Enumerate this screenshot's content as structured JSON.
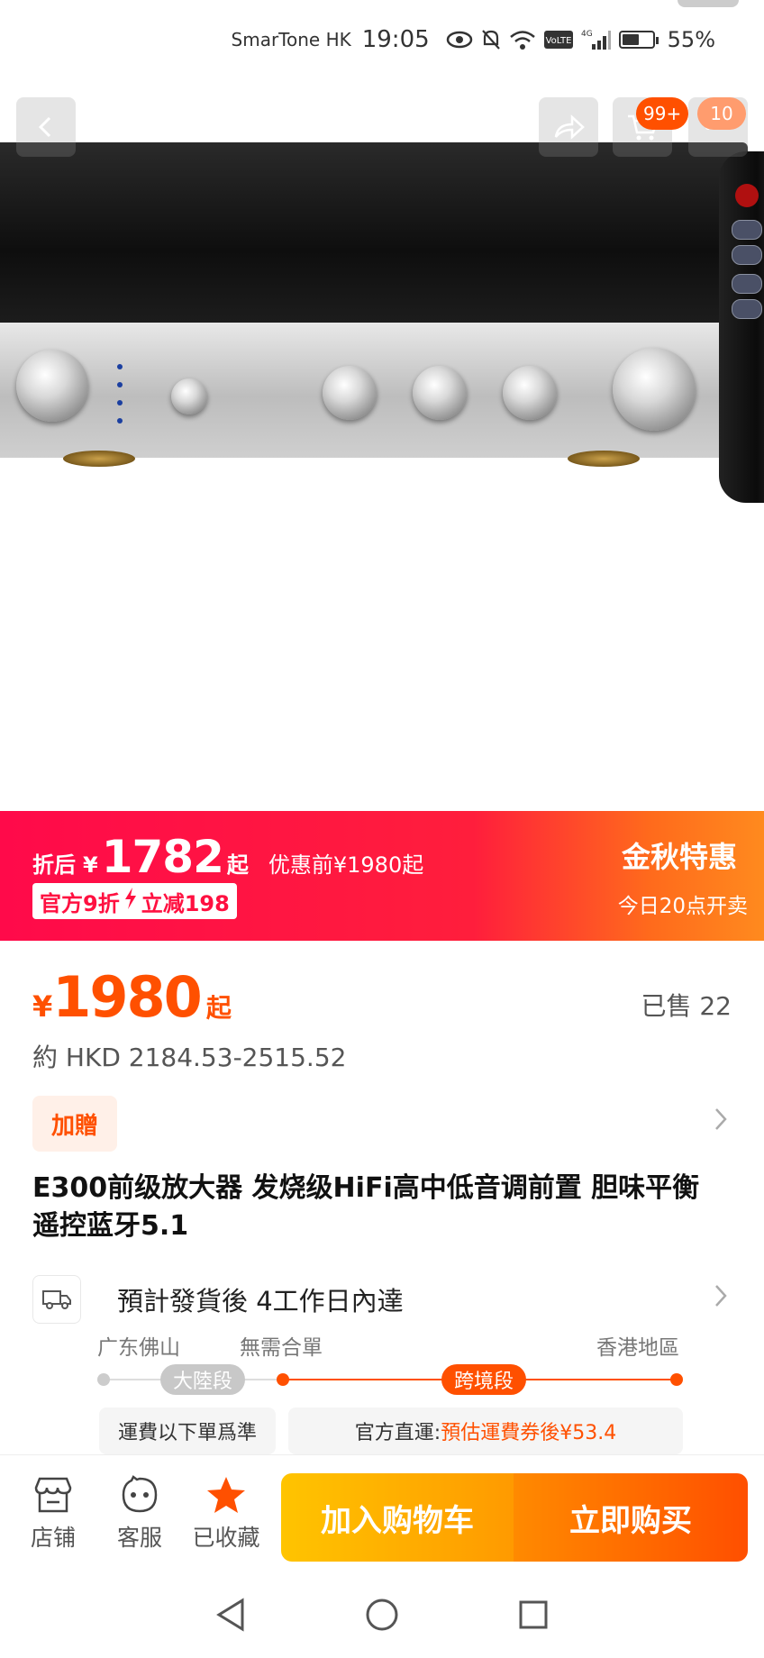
{
  "status_bar": {
    "carrier": "SmarTone HK",
    "time": "19:05",
    "network": "4G",
    "volte": "VoLTE",
    "battery_pct": "55%"
  },
  "header": {
    "cart_badge": "99+",
    "message_badge": "10"
  },
  "promo": {
    "after_label": "折后",
    "currency": "¥",
    "after_price": "1782",
    "after_suffix": "起",
    "before_text": "优惠前¥1980起",
    "tag_left": "官方9折",
    "tag_right": "立减198",
    "event_title": "金秋特惠",
    "event_time": "今日20点开卖"
  },
  "price": {
    "currency": "¥",
    "value": "1980",
    "suffix": "起",
    "sold": "已售 22",
    "hkd_range": "約 HKD 2184.53-2515.52"
  },
  "gift": {
    "label": "加贈"
  },
  "product": {
    "title": "E300前级放大器 发烧级HiFi高中低音调前置 胆味平衡 遥控蓝牙5.1"
  },
  "shipping": {
    "eta": "預計發貨後 4工作日內達",
    "origin": "广东佛山",
    "merge": "無需合單",
    "destination": "香港地區",
    "segment_mainland": "大陸段",
    "segment_cross": "跨境段",
    "fee_note": "運費以下單爲準",
    "direct_label": "官方直運:",
    "direct_fee": "預估運費券後¥53.4"
  },
  "bottom_bar": {
    "shop": "店铺",
    "service": "客服",
    "favorited": "已收藏",
    "add_to_cart": "加入购物车",
    "buy_now": "立即购买"
  },
  "colors": {
    "accent": "#ff5000",
    "promo_red": "#ff1040",
    "cart_yellow": "#ffc400"
  },
  "icons": [
    "back-icon",
    "share-icon",
    "cart-icon",
    "more-icon",
    "truck-icon",
    "chevron-right-icon",
    "shop-icon",
    "service-icon",
    "star-icon",
    "nav-back-icon",
    "nav-home-icon",
    "nav-recents-icon"
  ]
}
